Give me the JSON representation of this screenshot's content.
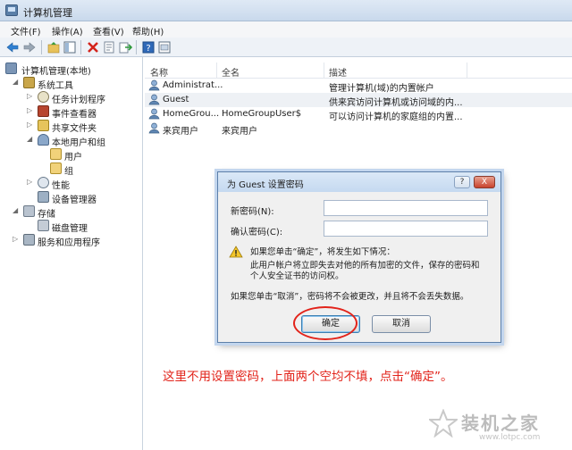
{
  "window": {
    "title": "计算机管理"
  },
  "menu": [
    "文件(F)",
    "操作(A)",
    "查看(V)",
    "帮助(H)"
  ],
  "toolbar_icons": [
    "back-arrow-icon",
    "forward-arrow-icon",
    "up-folder-icon",
    "show-hide-tree-icon",
    "delete-icon",
    "properties-icon",
    "export-icon",
    "help-icon",
    "console-icon"
  ],
  "tree": {
    "root": "计算机管理(本地)",
    "items": [
      {
        "label": "系统工具",
        "icon": "tools-icon"
      },
      {
        "label": "任务计划程序",
        "icon": "clock-icon"
      },
      {
        "label": "事件查看器",
        "icon": "event-viewer-icon"
      },
      {
        "label": "共享文件夹",
        "icon": "shared-folder-icon"
      },
      {
        "label": "本地用户和组",
        "icon": "users-icon"
      },
      {
        "label": "用户",
        "icon": "folder-icon"
      },
      {
        "label": "组",
        "icon": "folder-icon"
      },
      {
        "label": "性能",
        "icon": "performance-icon"
      },
      {
        "label": "设备管理器",
        "icon": "device-manager-icon"
      },
      {
        "label": "存储",
        "icon": "storage-icon"
      },
      {
        "label": "磁盘管理",
        "icon": "disk-icon"
      },
      {
        "label": "服务和应用程序",
        "icon": "services-icon"
      }
    ]
  },
  "list": {
    "headers": [
      "名称",
      "全名",
      "描述"
    ],
    "rows": [
      {
        "name": "Administrat...",
        "fullname": "",
        "desc": "管理计算机(域)的内置帐户"
      },
      {
        "name": "Guest",
        "fullname": "",
        "desc": "供来宾访问计算机或访问域的内..."
      },
      {
        "name": "HomeGrou...",
        "fullname": "HomeGroupUser$",
        "desc": "可以访问计算机的家庭组的内置..."
      },
      {
        "name": "来宾用户",
        "fullname": "来宾用户",
        "desc": ""
      }
    ]
  },
  "dialog": {
    "title": "为 Guest 设置密码",
    "help_btn": "?",
    "close_btn": "X",
    "new_password_label": "新密码(N):",
    "confirm_password_label": "确认密码(C):",
    "new_password_value": "",
    "confirm_password_value": "",
    "warning_line1": "如果您单击“确定”，将发生如下情况：",
    "warning_line2": "此用户帐户将立即失去对他的所有加密的文件，保存的密码和",
    "warning_line3": "个人安全证书的访问权。",
    "cancel_note": "如果您单击“取消”，密码将不会被更改，并且将不会丢失数据。",
    "ok_label": "确定",
    "cancel_label": "取消"
  },
  "annotation": "这里不用设置密码，上面两个空均不填，点击“确定”。",
  "watermark": {
    "text": "装机之家",
    "url": "www.lotpc.com"
  },
  "colors": {
    "annotation_red": "#e2231a",
    "selection": "#eef1f5"
  }
}
